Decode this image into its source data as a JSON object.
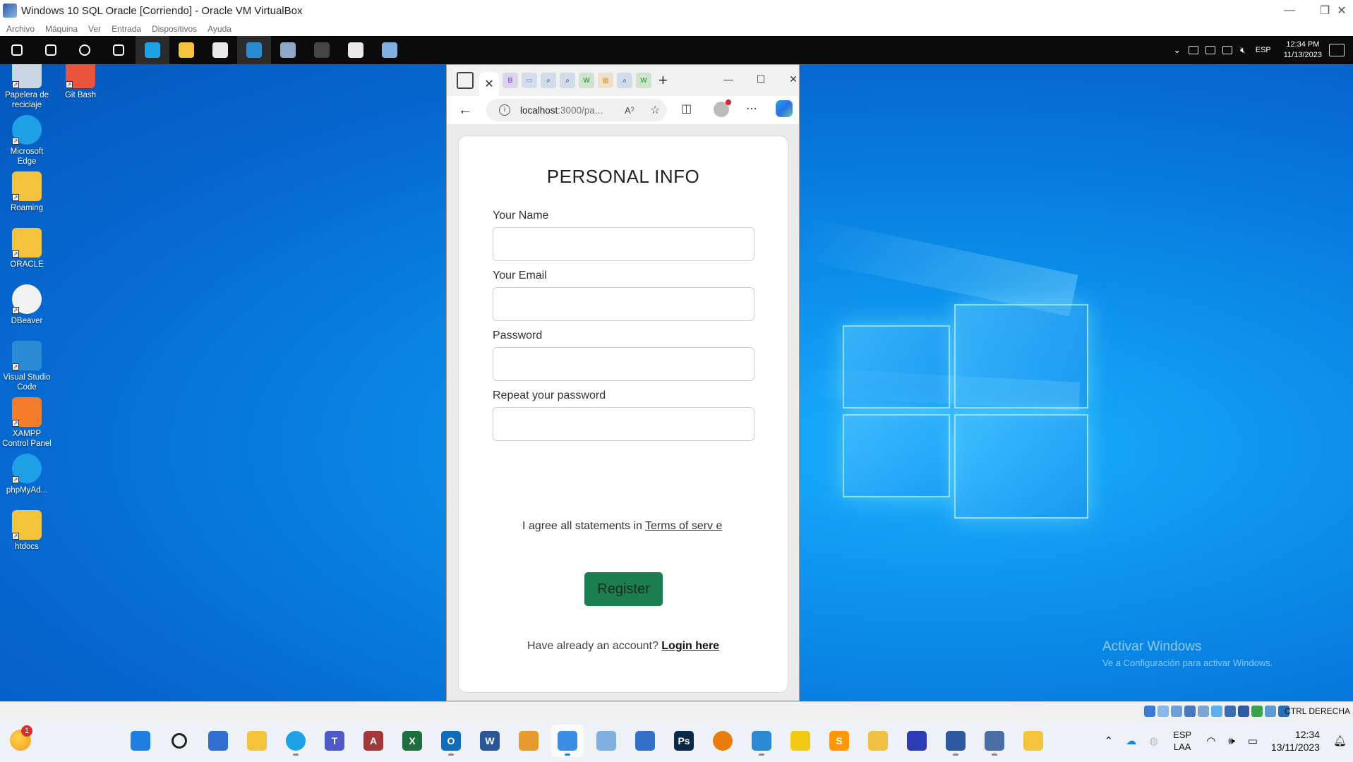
{
  "host_window": {
    "title": "Windows 10 SQL Oracle [Corriendo] - Oracle VM VirtualBox",
    "controls": {
      "minimize": "—",
      "restore": "❐",
      "close": "✕"
    }
  },
  "vb_menu": [
    "Archivo",
    "Máquina",
    "Ver",
    "Entrada",
    "Dispositivos",
    "Ayuda"
  ],
  "guest_taskbar": {
    "pinned": [
      {
        "name": "start-icon",
        "color": "#ffffff"
      },
      {
        "name": "search-icon",
        "color": "#ffffff"
      },
      {
        "name": "cortana-icon",
        "color": "#ffffff"
      },
      {
        "name": "task-view-icon",
        "color": "#ffffff"
      },
      {
        "name": "edge-icon",
        "color": "#1fa1e8"
      },
      {
        "name": "file-explorer-icon",
        "color": "#f3c33b"
      },
      {
        "name": "dbeaver-icon",
        "color": "#e8e8e8"
      },
      {
        "name": "vscode-icon",
        "color": "#2a8ad4"
      },
      {
        "name": "app-icon",
        "color": "#8fa8c8"
      },
      {
        "name": "terminal-icon",
        "color": "#444444"
      },
      {
        "name": "dbeaver-icon",
        "color": "#e8e8e8"
      },
      {
        "name": "app-icon",
        "color": "#7fb0e0"
      }
    ],
    "lang": "ESP",
    "time": "12:34 PM",
    "date": "11/13/2023"
  },
  "desktop_icons": [
    {
      "label": "Papelera de reciclaje",
      "icon": "recycle-bin-icon",
      "color": "#c9d6e3"
    },
    {
      "label": "Git Bash",
      "icon": "git-bash-icon",
      "color": "#e8553a"
    },
    {
      "label": "Microsoft Edge",
      "icon": "edge-icon",
      "color": "#1fa1e8"
    },
    {
      "label": "Roaming",
      "icon": "folder-icon",
      "color": "#f3c33b"
    },
    {
      "label": "ORACLE",
      "icon": "folder-icon",
      "color": "#f3c33b"
    },
    {
      "label": "DBeaver",
      "icon": "dbeaver-icon",
      "color": "#f2f2f2"
    },
    {
      "label": "Visual Studio Code",
      "icon": "vscode-icon",
      "color": "#2a8ad4"
    },
    {
      "label": "XAMPP Control Panel",
      "icon": "xampp-icon",
      "color": "#f57c2a"
    },
    {
      "label": "phpMyAd...",
      "icon": "edge-icon",
      "color": "#1fa1e8"
    },
    {
      "label": "htdocs",
      "icon": "folder-icon",
      "color": "#f3c33b"
    }
  ],
  "activate_windows": {
    "title": "Activar Windows",
    "subtitle": "Ve a Configuración para activar Windows."
  },
  "browser": {
    "tab_close": "✕",
    "new_tab": "+",
    "mini_tabs": [
      {
        "glyph": "B",
        "color": "#8e63ce"
      },
      {
        "glyph": "▭",
        "color": "#6b8bd6"
      },
      {
        "glyph": "⌕",
        "color": "#5a86c7"
      },
      {
        "glyph": "⌕",
        "color": "#5a86c7"
      },
      {
        "glyph": "W",
        "color": "#4caf50"
      },
      {
        "glyph": "▦",
        "color": "#e6a23c"
      },
      {
        "glyph": "⌕",
        "color": "#5a86c7"
      },
      {
        "glyph": "W",
        "color": "#4caf50"
      }
    ],
    "url_host": "localhost",
    "url_rest": ":3000/pa...",
    "read_aloud": "Aˀ",
    "controls": {
      "minimize": "—",
      "maximize": "☐",
      "close": "✕"
    }
  },
  "form": {
    "title": "PERSONAL INFO",
    "name_label": "Your Name",
    "email_label": "Your Email",
    "password_label": "Password",
    "repeat_label": "Repeat your password",
    "agree_text": "I agree all statements in ",
    "terms_link": "Terms of serv  e",
    "register_label": "Register",
    "have_account": "Have already an account? ",
    "login_link": "Login here"
  },
  "vb_status": {
    "host_key": "CTRL DERECHA"
  },
  "host_taskbar": {
    "weather_badge": "1",
    "apps": [
      {
        "name": "windows-start-icon",
        "color": "#1e7fe0",
        "glyph": ""
      },
      {
        "name": "search-icon",
        "color": "#eef1f6",
        "glyph": ""
      },
      {
        "name": "store-icon",
        "color": "#2f6fcf",
        "glyph": ""
      },
      {
        "name": "file-explorer-icon",
        "color": "#f3c33b",
        "glyph": ""
      },
      {
        "name": "edge-icon",
        "color": "#1fa1e8",
        "glyph": ""
      },
      {
        "name": "teams-icon",
        "color": "#5059c9",
        "glyph": "T"
      },
      {
        "name": "access-icon",
        "color": "#a4373a",
        "glyph": "A"
      },
      {
        "name": "excel-icon",
        "color": "#1d6f42",
        "glyph": "X"
      },
      {
        "name": "outlook-icon",
        "color": "#0f6cbd",
        "glyph": "O"
      },
      {
        "name": "word-icon",
        "color": "#2b579a",
        "glyph": "W"
      },
      {
        "name": "app-icon",
        "color": "#e59a2c",
        "glyph": ""
      },
      {
        "name": "snipping-tool-icon",
        "color": "#3a8ee6",
        "glyph": ""
      },
      {
        "name": "app-icon",
        "color": "#7fb0e0",
        "glyph": ""
      },
      {
        "name": "notepad-icon",
        "color": "#3470c9",
        "glyph": ""
      },
      {
        "name": "photoshop-icon",
        "color": "#0b2a4a",
        "glyph": "Ps"
      },
      {
        "name": "blender-icon",
        "color": "#e87d0d",
        "glyph": ""
      },
      {
        "name": "vscode-icon",
        "color": "#2a8ad4",
        "glyph": ""
      },
      {
        "name": "power-bi-icon",
        "color": "#f2c811",
        "glyph": ""
      },
      {
        "name": "sublime-icon",
        "color": "#ff9800",
        "glyph": "S"
      },
      {
        "name": "app-icon",
        "color": "#f0c040",
        "glyph": ""
      },
      {
        "name": "audacity-icon",
        "color": "#2a3bb5",
        "glyph": ""
      },
      {
        "name": "virtualbox-icon",
        "color": "#2c5aa0",
        "glyph": ""
      },
      {
        "name": "app-icon",
        "color": "#4a6fa5",
        "glyph": ""
      },
      {
        "name": "folder-icon",
        "color": "#f3c33b",
        "glyph": ""
      }
    ],
    "lang_top": "ESP",
    "lang_bottom": "LAA",
    "time": "12:34",
    "date": "13/11/2023"
  }
}
